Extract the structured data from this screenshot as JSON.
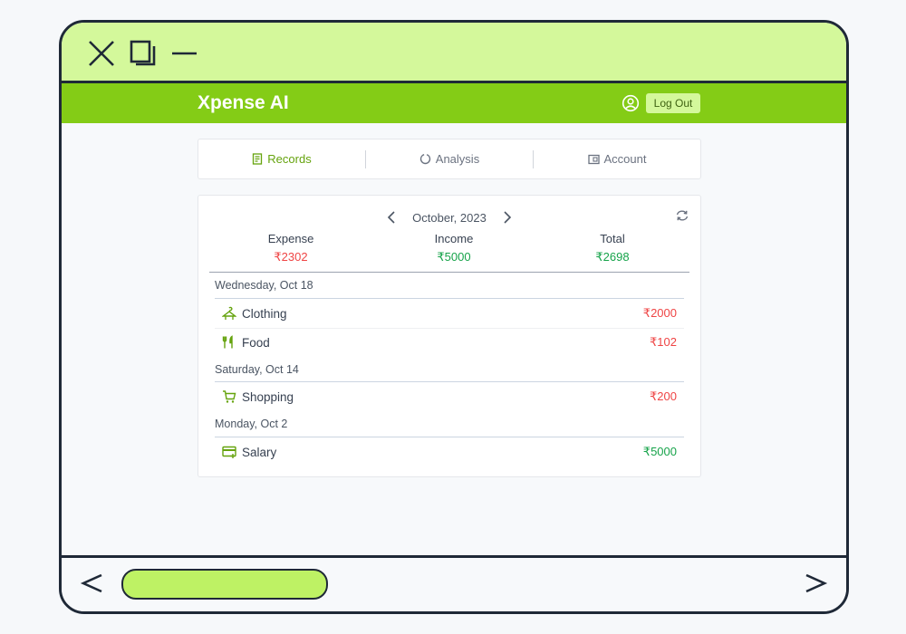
{
  "app": {
    "name": "Xpense AI",
    "logout_label": "Log Out"
  },
  "tabs": [
    {
      "label": "Records",
      "icon": "records-icon",
      "active": true
    },
    {
      "label": "Analysis",
      "icon": "analysis-icon",
      "active": false
    },
    {
      "label": "Account",
      "icon": "account-icon",
      "active": false
    }
  ],
  "month": "October, 2023",
  "summary": {
    "expense": {
      "label": "Expense",
      "value": "₹2302"
    },
    "income": {
      "label": "Income",
      "value": "₹5000"
    },
    "total": {
      "label": "Total",
      "value": "₹2698"
    }
  },
  "groups": [
    {
      "date": "Wednesday, Oct 18",
      "records": [
        {
          "category": "Clothing",
          "icon": "clothing-icon",
          "amount": "₹2000",
          "type": "expense"
        },
        {
          "category": "Food",
          "icon": "food-icon",
          "amount": "₹102",
          "type": "expense"
        }
      ]
    },
    {
      "date": "Saturday, Oct 14",
      "records": [
        {
          "category": "Shopping",
          "icon": "cart-icon",
          "amount": "₹200",
          "type": "expense"
        }
      ]
    },
    {
      "date": "Monday, Oct 2",
      "records": [
        {
          "category": "Salary",
          "icon": "salary-icon",
          "amount": "₹5000",
          "type": "income"
        }
      ]
    }
  ],
  "colors": {
    "brand": "#84cc16",
    "expense": "#ef4444",
    "income": "#16a34a"
  }
}
